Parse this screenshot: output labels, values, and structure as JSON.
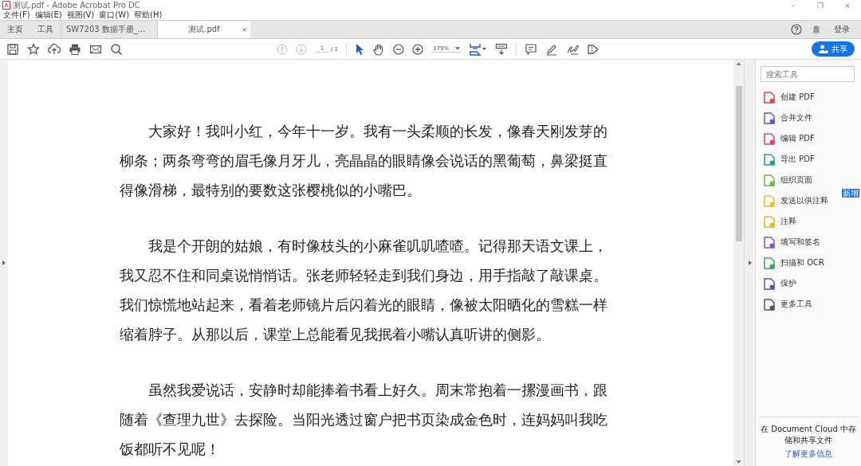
{
  "window": {
    "title": "测试.pdf - Adobe Acrobat Pro DC",
    "controls": [
      "–",
      "❐",
      "×"
    ]
  },
  "menu": [
    "文件(F)",
    "编辑(E)",
    "视图(V)",
    "窗口(W)",
    "帮助(H)"
  ],
  "nav": [
    {
      "label": "主页",
      "selected": false
    },
    {
      "label": "工具",
      "selected": false
    }
  ],
  "tabs": [
    {
      "label": "SW7203 数据手册_...",
      "selected": false
    },
    {
      "label": "测试.pdf",
      "selected": true,
      "close": "×"
    }
  ],
  "account": {
    "login": "登录"
  },
  "toolbar": {
    "page": "1",
    "total": "/ 1",
    "zoom": "179%",
    "share": "共享"
  },
  "document": {
    "paragraphs": [
      "大家好！我叫小红，今年十一岁。我有一头柔顺的长发，像春天刚发芽的柳条；两条弯弯的眉毛像月牙儿，亮晶晶的眼睛像会说话的黑葡萄，鼻梁挺直得像滑梯，最特别的要数这张樱桃似的小嘴巴。",
      "我是个开朗的姑娘，有时像枝头的小麻雀叽叽喳喳。记得那天语文课上，我又忍不住和同桌说悄悄话。张老师轻轻走到我们身边，用手指敲了敲课桌。我们惊慌地站起来，看着老师镜片后闪着光的眼睛，像被太阳晒化的雪糕一样缩着脖子。从那以后，课堂上总能看见我抿着小嘴认真听讲的侧影。",
      "虽然我爱说话，安静时却能捧着书看上好久。周末常抱着一摞漫画书，跟随着《查理九世》去探险。当阳光透过窗户把书页染成金色时，连妈妈叫我吃饭都听不见呢！"
    ]
  },
  "tools_pane": {
    "search": {
      "placeholder": "搜索工具"
    },
    "tools": [
      {
        "label": "创建 PDF",
        "color": "#e0474c"
      },
      {
        "label": "合并文件",
        "color": "#5b5bd6"
      },
      {
        "label": "编辑 PDF",
        "color": "#e0427a"
      },
      {
        "label": "导出 PDF",
        "color": "#22a38a"
      },
      {
        "label": "组织页面",
        "color": "#6dbb3f"
      },
      {
        "label": "发送以供注释",
        "color": "#e5c02a",
        "badge": "新增"
      },
      {
        "label": "注释",
        "color": "#e5b420"
      },
      {
        "label": "填写和签名",
        "color": "#8a4fd0"
      },
      {
        "label": "扫描和 OCR",
        "color": "#3aa655"
      },
      {
        "label": "保护",
        "color": "#5555c8"
      },
      {
        "label": "更多工具",
        "color": "#555555"
      }
    ],
    "cloud_text": "在 Document Cloud 中存储和共享文件",
    "cloud_link": "了解更多信息"
  }
}
